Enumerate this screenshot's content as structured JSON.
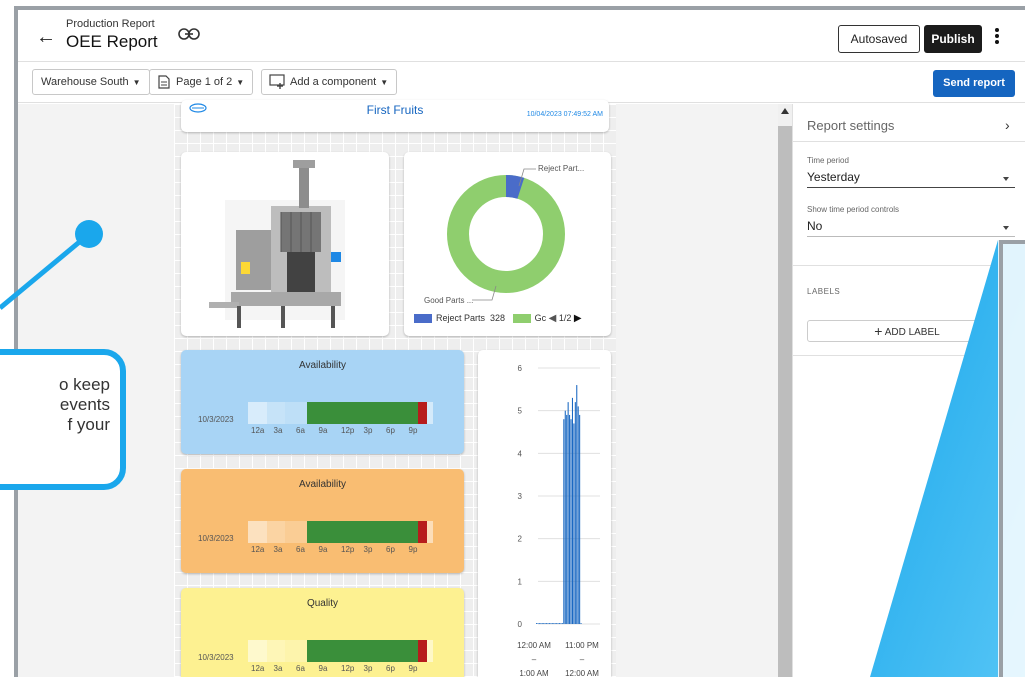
{
  "header": {
    "parent": "Production Report",
    "title": "OEE Report",
    "autosaved_label": "Autosaved",
    "publish_label": "Publish"
  },
  "toolbar": {
    "location": "Warehouse South",
    "page": "Page 1 of 2",
    "add_component": "Add a component",
    "send_label": "Send report"
  },
  "report_header": {
    "name": "First Fruits",
    "datetime": "10/04/2023 07:49:52 AM"
  },
  "donut": {
    "label_reject": "Reject Part...",
    "label_good": "Good Parts ...",
    "legend": [
      {
        "label": "Reject Parts",
        "value": "328",
        "color": "#4a6cc9"
      },
      {
        "label": "Gc",
        "color": "#8fce6e"
      }
    ],
    "pager": "1/2",
    "reject_fraction": 0.05
  },
  "timelines": [
    {
      "title": "Availability",
      "date": "10/3/2023",
      "bg": "#a8d4f5"
    },
    {
      "title": "Availability",
      "date": "10/3/2023",
      "bg": "#f9bd72"
    },
    {
      "title": "Quality",
      "date": "10/3/2023",
      "bg": "#fdf191"
    }
  ],
  "timeline_ticks": [
    "12a",
    "3a",
    "6a",
    "9a",
    "12p",
    "3p",
    "6p",
    "9p"
  ],
  "chart_data": {
    "type": "bar",
    "y_ticks": [
      "0",
      "1",
      "2",
      "3",
      "4",
      "5",
      "6"
    ],
    "ylim": [
      0,
      6
    ],
    "x_labels_top": [
      "12:00 AM",
      "11:00 PM"
    ],
    "x_dashes": [
      "–",
      "–"
    ],
    "x_labels_bottom": [
      "1:00 AM",
      "12:00 AM"
    ],
    "values": [
      0.02,
      0.02,
      0.02,
      0.02,
      0.02,
      0.02,
      0.02,
      0.02,
      0.02,
      0.02,
      0.02,
      0.02,
      0.02,
      0.02,
      0.02,
      0.02,
      0.02,
      0.02,
      0.02,
      4.8,
      5.0,
      4.9,
      5.2,
      4.9,
      4.8,
      5.3,
      4.7,
      5.2,
      5.6,
      5.1,
      4.9,
      0.02
    ]
  },
  "panel": {
    "title": "Report settings",
    "time_period_label": "Time period",
    "time_period_value": "Yesterday",
    "controls_label": "Show time period controls",
    "controls_value": "No",
    "labels_heading": "LABELS",
    "add_label": "ADD LABEL"
  },
  "callout": {
    "line1": "o  keep",
    "line2": "events",
    "line3": "f   your"
  },
  "colors": {
    "accent": "#1565c0",
    "callout": "#1aa7ec",
    "good_dark": "#3a8f3a",
    "reject_red": "#b71c1c"
  }
}
